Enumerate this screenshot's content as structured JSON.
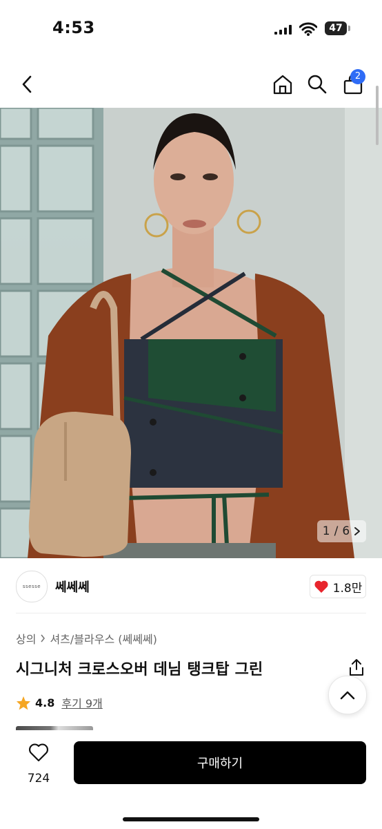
{
  "status_bar": {
    "time": "4:53",
    "battery": "47"
  },
  "nav": {
    "back_icon": "chevron-left-icon",
    "home_icon": "home-icon",
    "search_icon": "search-icon",
    "cart_icon": "shopping-bag-icon",
    "cart_count": "2"
  },
  "gallery": {
    "current": "1",
    "separator": "/",
    "total": "6",
    "next_icon": "chevron-right-icon"
  },
  "seller": {
    "logo_text": "ssesse",
    "name": "쎄쎄쎄",
    "likes": "1.8만"
  },
  "product": {
    "breadcrumb": [
      "상의",
      "셔츠/블라우스 (쎄쎄쎄)"
    ],
    "title": "시그니처 크로스오버 데님 탱크탑 그린",
    "rating": "4.8",
    "reviews": "후기 9개"
  },
  "bottom_bar": {
    "wish_count": "724",
    "buy_label": "구매하기"
  },
  "colors": {
    "accent": "#2f6cf6",
    "heart": "#e8252d",
    "star": "#f5a623",
    "buy_button": "#000000"
  }
}
